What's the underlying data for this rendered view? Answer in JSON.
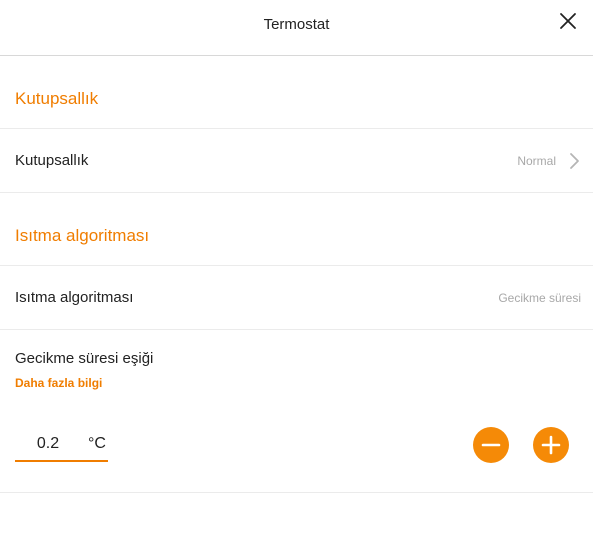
{
  "header": {
    "title": "Termostat"
  },
  "polarity_section": {
    "title": "Kutupsallık",
    "row": {
      "label": "Kutupsallık",
      "value": "Normal"
    }
  },
  "heating_section": {
    "title": "Isıtma algoritması",
    "row": {
      "label": "Isıtma algoritması",
      "value": "Gecikme süresi"
    }
  },
  "delay_threshold": {
    "label": "Gecikme süresi eşiği",
    "more_info_link": "Daha fazla bilgi",
    "value": "0.2",
    "unit": "°C"
  },
  "colors": {
    "accent": "#f07d00",
    "button": "#f58a07",
    "divider": "#ebebeb",
    "muted_text": "#a8a8a8"
  },
  "icons": {
    "close": "close-icon",
    "chevron": "chevron-right-icon",
    "minus": "minus-icon",
    "plus": "plus-icon"
  }
}
